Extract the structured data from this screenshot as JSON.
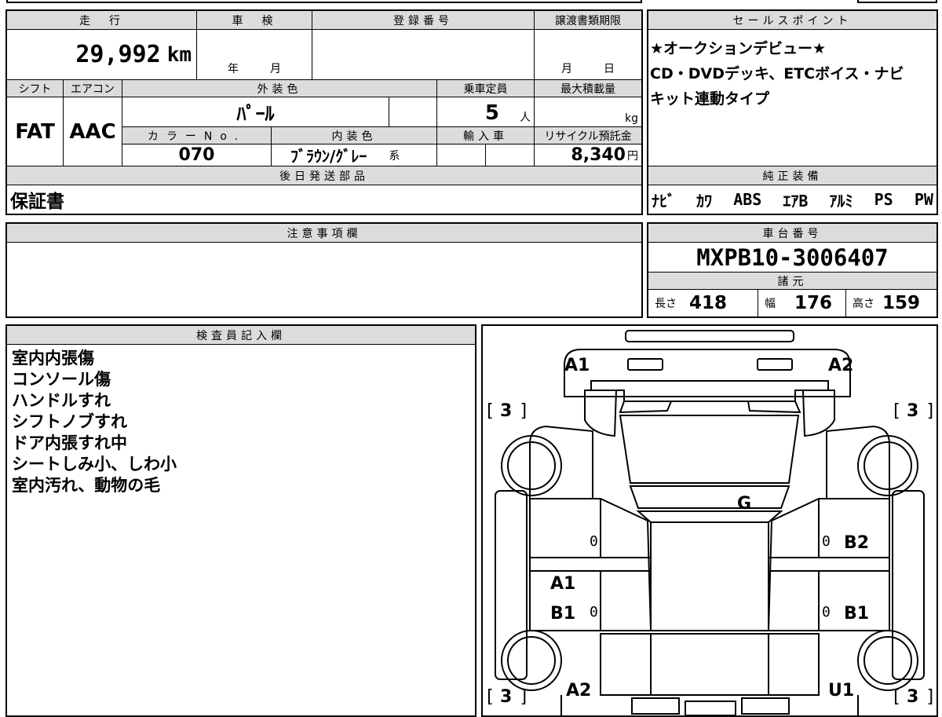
{
  "top_row": {
    "odometer_header": "走　行",
    "odometer_value": "29,992",
    "odometer_unit": "km",
    "inspection_header": "車　検",
    "inspection_year": "年",
    "inspection_month": "月",
    "registration_header": "登録番号",
    "transfer_deadline_header": "譲渡書類期限",
    "transfer_month": "月",
    "transfer_day": "日"
  },
  "mid_row": {
    "shift_header": "シフト",
    "shift_value": "FAT",
    "aircon_header": "エアコン",
    "aircon_value": "AAC",
    "exterior_color_header": "外装色",
    "exterior_color_value": "ﾊﾟｰﾙ",
    "capacity_header": "乗車定員",
    "capacity_value": "5",
    "capacity_unit": "人",
    "max_load_header": "最大積載量",
    "max_load_unit": "kg",
    "color_no_header": "カラーNo.",
    "color_no_value": "070",
    "interior_color_header": "内装色",
    "interior_color_value": "ﾌﾞﾗｳﾝ/ｸﾞﾚｰ",
    "interior_color_suffix": "系",
    "import_header": "輸入車",
    "recycle_header": "リサイクル預託金",
    "recycle_value": "8,340",
    "recycle_unit": "円"
  },
  "later_parts": {
    "header": "後日発送部品",
    "value": "保証書"
  },
  "sales_points": {
    "header": "セールスポイント",
    "lines": [
      "★オークションデビュー★",
      "CD・DVDデッキ、ETCボイス・ナビ",
      "キット連動タイプ"
    ]
  },
  "genuine_equipment": {
    "header": "純正装備",
    "items": [
      "ﾅﾋﾞ",
      "ｶﾜ",
      "ABS",
      "ｴｱB",
      "ｱﾙﾐ",
      "PS",
      "PW"
    ]
  },
  "notes": {
    "header": "注意事項欄"
  },
  "chassis": {
    "header": "車台番号",
    "value": "MXPB10-3006407"
  },
  "specs": {
    "header": "諸元",
    "length_label": "長さ",
    "length_value": "418",
    "width_label": "幅",
    "width_value": "176",
    "height_label": "高さ",
    "height_value": "159"
  },
  "inspector": {
    "header": "検査員記入欄",
    "lines": [
      "室内内張傷",
      "コンソール傷",
      "ハンドルすれ",
      "シフトノブすれ",
      "ドア内張すれ中",
      "シートしみ小、しわ小",
      "室内汚れ、動物の毛"
    ]
  },
  "diagram": {
    "labels": {
      "a1_top": "A1",
      "a2_top": "A2",
      "g": "G",
      "b2": "B2",
      "a1_left": "A1",
      "b1_left": "B1",
      "b1_right": "B1",
      "a2_bottom": "A2",
      "u1": "U1"
    },
    "tire_top_left": "3",
    "tire_top_right": "3",
    "tire_bottom_left": "3",
    "tire_bottom_right": "3",
    "zero_1": "0",
    "zero_2": "0",
    "zero_3": "0",
    "zero_4": "0",
    "bracket_open": "[",
    "bracket_close": "]"
  },
  "colors": {
    "header_bg": "#dcdcdc",
    "line": "#000000"
  }
}
